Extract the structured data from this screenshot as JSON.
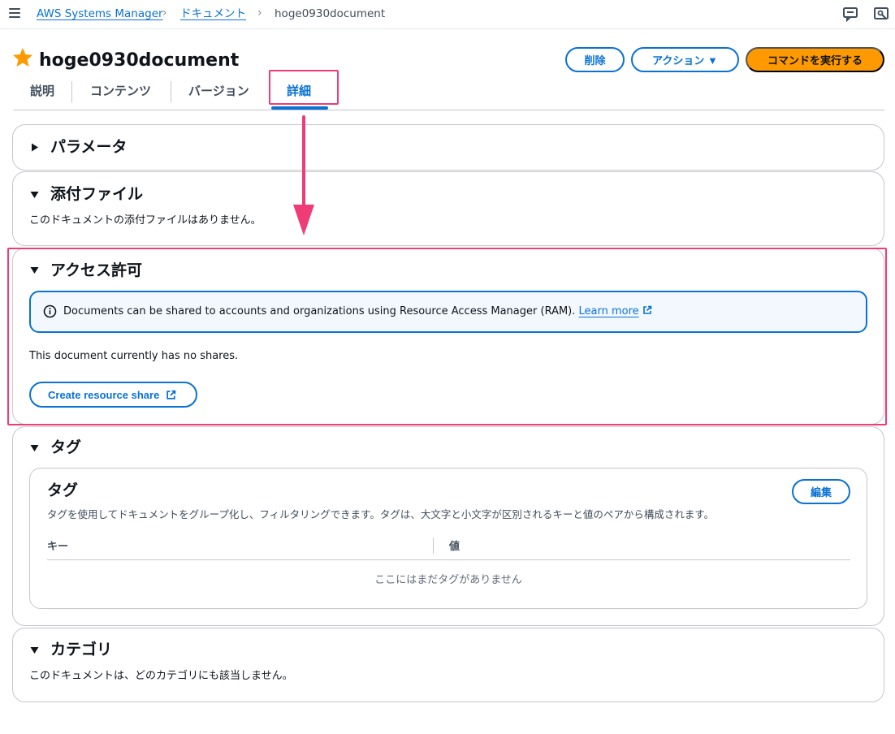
{
  "breadcrumb": {
    "items": [
      "AWS Systems Manager",
      "ドキュメント"
    ],
    "current": "hoge0930document"
  },
  "header": {
    "title": "hoge0930document",
    "delete_label": "削除",
    "actions_label": "アクション ▼",
    "run_label": "コマンドを実行する"
  },
  "tabs": [
    "説明",
    "コンテンツ",
    "バージョン",
    "詳細"
  ],
  "active_tab": "詳細",
  "sections": {
    "parameters": {
      "title": "パラメータ"
    },
    "attachments": {
      "title": "添付ファイル",
      "text": "このドキュメントの添付ファイルはありません。"
    },
    "permissions": {
      "title": "アクセス許可",
      "info_text": "Documents can be shared to accounts and organizations using Resource Access Manager (RAM).",
      "learn_more": "Learn more",
      "no_shares": "This document currently has no shares.",
      "create_share_label": "Create resource share"
    },
    "tags": {
      "title": "タグ",
      "card_title": "タグ",
      "edit_label": "編集",
      "description": "タグを使用してドキュメントをグループ化し、フィルタリングできます。タグは、大文字と小文字が区別されるキーと値のペアから構成されます。",
      "columns": [
        "キー",
        "値"
      ],
      "empty_text": "ここにはまだタグがありません"
    },
    "category": {
      "title": "カテゴリ",
      "text": "このドキュメントは、どのカテゴリにも該当しません。"
    }
  },
  "colors": {
    "accent": "#0972d3",
    "primary_button": "#ff9900",
    "highlight": "#ef3b76",
    "star": "#ff9900"
  }
}
